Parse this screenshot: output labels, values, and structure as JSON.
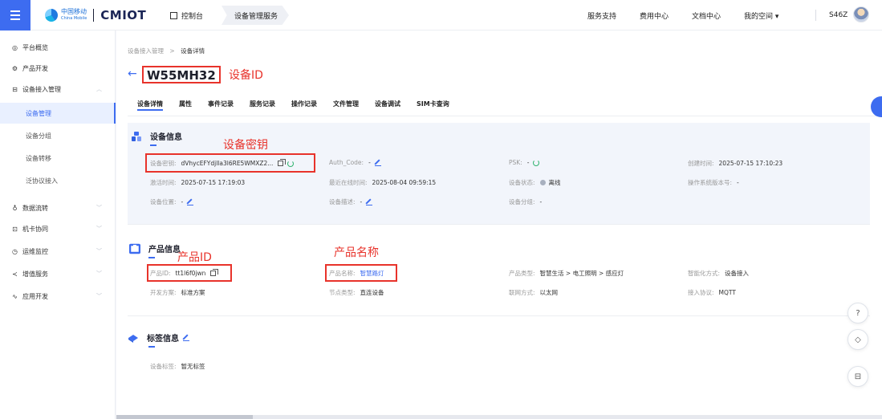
{
  "topbar": {
    "brand_cn": "中国移动",
    "brand_en": "China Mobile",
    "product": "CMIOT",
    "console": "控制台",
    "device_service": "设备管理服务",
    "links": [
      "服务支持",
      "费用中心",
      "文档中心",
      "我的空间 ▾"
    ],
    "user": "S46Z"
  },
  "sidebar": {
    "items": [
      {
        "label": "平台概览",
        "icon": "dashboard-icon",
        "glyph": "◎",
        "arrow": ""
      },
      {
        "label": "产品开发",
        "icon": "product-icon",
        "glyph": "⚙",
        "arrow": ""
      },
      {
        "label": "设备接入管理",
        "icon": "device-access-icon",
        "glyph": "⊟",
        "arrow": "︿"
      },
      {
        "label": "设备管理",
        "sub": true,
        "active": true
      },
      {
        "label": "设备分组",
        "sub": true
      },
      {
        "label": "设备转移",
        "sub": true
      },
      {
        "label": "泛协议接入",
        "sub": true
      },
      {
        "label": "数据流转",
        "icon": "data-flow-icon",
        "glyph": "♁",
        "arrow": "﹀"
      },
      {
        "label": "机卡协同",
        "icon": "card-icon",
        "glyph": "⊡",
        "arrow": "﹀"
      },
      {
        "label": "运维监控",
        "icon": "monitor-icon",
        "glyph": "◷",
        "arrow": "﹀"
      },
      {
        "label": "增值服务",
        "icon": "value-added-icon",
        "glyph": "≺",
        "arrow": "﹀"
      },
      {
        "label": "应用开发",
        "icon": "app-dev-icon",
        "glyph": "∿",
        "arrow": "﹀"
      }
    ]
  },
  "breadcrumb": {
    "parent": "设备接入管理",
    "sep": ">",
    "current": "设备详情"
  },
  "device": {
    "name": "W55MH32"
  },
  "annotations": {
    "device_id": "设备ID",
    "device_key": "设备密钥",
    "product_id": "产品ID",
    "product_name": "产品名称"
  },
  "tabs": [
    "设备详情",
    "属性",
    "事件记录",
    "服务记录",
    "操作记录",
    "文件管理",
    "设备调试",
    "SIM卡查询"
  ],
  "device_info": {
    "title": "设备信息",
    "key_label": "设备密钥:",
    "key_value": "dVhycEFYdjlla3l6RE5WMXZ2...",
    "auth_label": "Auth_Code:",
    "auth_value": "-",
    "psk_label": "PSK:",
    "psk_value": "-",
    "created_label": "创建时间:",
    "created_value": "2025-07-15 17:10:23",
    "activated_label": "激活时间:",
    "activated_value": "2025-07-15 17:19:03",
    "last_online_label": "最近在线时间:",
    "last_online_value": "2025-08-04 09:59:15",
    "status_label": "设备状态:",
    "status_value": "离线",
    "os_label": "操作系统版本号:",
    "os_value": "-",
    "location_label": "设备位置:",
    "location_value": "-",
    "desc_label": "设备描述:",
    "desc_value": "-",
    "group_label": "设备分组:",
    "group_value": "-"
  },
  "product_info": {
    "title": "产品信息",
    "id_label": "产品ID:",
    "id_value": "tt1l6f0jwn",
    "name_label": "产品名称:",
    "name_value": "智慧路灯",
    "type_label": "产品类型:",
    "type_value": "智慧生活 > 电工照明 > 感应灯",
    "smart_label": "智能化方式:",
    "smart_value": "设备接入",
    "dev_label": "开发方案:",
    "dev_value": "标准方案",
    "node_label": "节点类型:",
    "node_value": "直连设备",
    "net_label": "联网方式:",
    "net_value": "以太网",
    "proto_label": "接入协议:",
    "proto_value": "MQTT"
  },
  "tag_info": {
    "title": "标签信息",
    "tags_label": "设备标签:",
    "tags_value": "暂无标签"
  },
  "colors": {
    "accent": "#3d6cf0",
    "annotation": "#e8332b",
    "online_refresh": "#2fb36e"
  }
}
